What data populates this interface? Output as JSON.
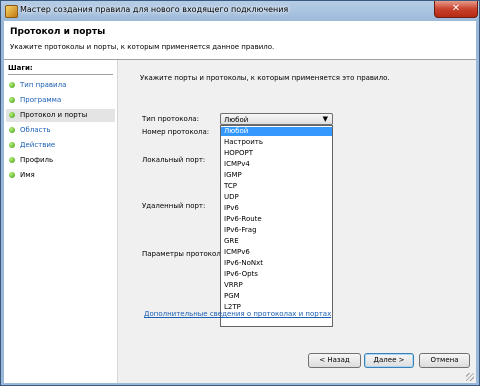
{
  "window": {
    "title": "Мастер создания правила для нового входящего подключения",
    "close_label": "✕"
  },
  "header": {
    "title": "Протокол и порты",
    "subtitle": "Укажите протоколы и порты, к которым применяется данное правило."
  },
  "sidebar": {
    "heading": "Шаги:",
    "steps": [
      {
        "label": "Тип правила"
      },
      {
        "label": "Программа"
      },
      {
        "label": "Протокол и порты"
      },
      {
        "label": "Область"
      },
      {
        "label": "Действие"
      },
      {
        "label": "Профиль"
      },
      {
        "label": "Имя"
      }
    ]
  },
  "main": {
    "prompt": "Укажите порты и протоколы, к которым применяется это правило.",
    "protocol_type_label": "Тип протокола:",
    "protocol_number_label": "Номер протокола:",
    "local_port_label": "Локальный порт:",
    "remote_port_label": "Удаленный порт:",
    "icmp_params_label": "Параметры протокола",
    "protocol_select": {
      "value": "Любой",
      "options": [
        "Любой",
        "Настроить",
        "HOPOPT",
        "ICMPv4",
        "IGMP",
        "TCP",
        "UDP",
        "IPv6",
        "IPv6-Route",
        "IPv6-Frag",
        "GRE",
        "ICMPv6",
        "IPv6-NoNxt",
        "IPv6-Opts",
        "VRRP",
        "PGM",
        "L2TP"
      ]
    },
    "more_link": "Дополнительные сведения о протоколах и портах"
  },
  "buttons": {
    "back": "< Назад",
    "next": "Далее >",
    "cancel": "Отмена"
  }
}
